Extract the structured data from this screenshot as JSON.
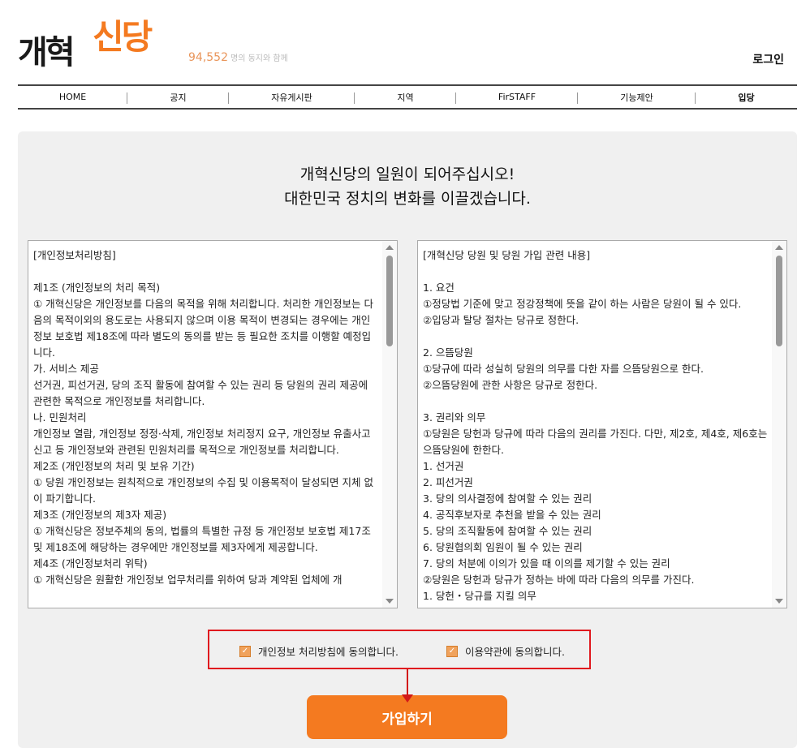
{
  "header": {
    "logo": {
      "black_text": "개혁",
      "orange_text": "신당"
    },
    "member_count": "94,552",
    "member_suffix": "명의 동지와 함께",
    "login_label": "로그인"
  },
  "nav": {
    "items": [
      {
        "label": "HOME"
      },
      {
        "label": "공지"
      },
      {
        "label": "자유게시판"
      },
      {
        "label": "지역"
      },
      {
        "label": "FirSTAFF"
      },
      {
        "label": "기능제안"
      },
      {
        "label": "입당"
      }
    ]
  },
  "main": {
    "headline_line1": "개혁신당의 일원이 되어주십시오!",
    "headline_line2": "대한민국 정치의 변화를 이끌겠습니다.",
    "privacy_text": "[개인정보처리방침]\n\n제1조 (개인정보의 처리 목적)\n① 개혁신당은 개인정보를 다음의 목적을 위해 처리합니다. 처리한 개인정보는 다음의 목적이외의 용도로는 사용되지 않으며 이용 목적이 변경되는 경우에는 개인정보 보호법 제18조에 따라 별도의 동의를 받는 등 필요한 조치를 이행할 예정입니다.\n가. 서비스 제공\n선거권, 피선거권, 당의 조직 활동에 참여할 수 있는 권리 등 당원의 권리 제공에 관련한 목적으로 개인정보를 처리합니다.\n나. 민원처리\n개인정보 열람, 개인정보 정정·삭제, 개인정보 처리정지 요구, 개인정보 유출사고 신고 등 개인정보와 관련된 민원처리를 목적으로 개인정보를 처리합니다.\n제2조 (개인정보의 처리 및 보유 기간)\n① 당원 개인정보는 원칙적으로 개인정보의 수집 및 이용목적이 달성되면 지체 없이 파기합니다.\n제3조 (개인정보의 제3자 제공)\n① 개혁신당은 정보주체의 동의, 법률의 특별한 규정 등 개인정보 보호법 제17조 및 제18조에 해당하는 경우에만 개인정보를 제3자에게 제공합니다.\n제4조 (개인정보처리 위탁)\n① 개혁신당은 원활한 개인정보 업무처리를 위하여 당과 계약된 업체에 개",
    "terms_text": "[개혁신당 당원 및 당원 가입 관련 내용]\n\n1. 요건\n①정당법 기준에 맞고 정강정책에 뜻을 같이 하는 사람은 당원이 될 수 있다.\n②입당과 탈당 절차는 당규로 정한다.\n\n2. 으뜸당원\n①당규에 따라 성실히 당원의 의무를 다한 자를 으뜸당원으로 한다.\n②으뜸당원에 관한 사항은 당규로 정한다.\n\n3. 권리와 의무\n①당원은 당헌과 당규에 따라 다음의 권리를 가진다. 다만, 제2호, 제4호, 제6호는 으뜸당원에 한한다.\n1. 선거권\n2. 피선거권\n3. 당의 의사결정에 참여할 수 있는 권리\n4. 공직후보자로 추천을 받을 수 있는 권리\n5. 당의 조직활동에 참여할 수 있는 권리\n6. 당원협의회 임원이 될 수 있는 권리\n7. 당의 처분에 이의가 있을 때 이의를 제기할 수 있는 권리\n②당원은 당헌과 당규가 정하는 바에 따라 다음의 의무를 가진다.\n1. 당헌・당규를 지킬 의무"
  },
  "agreements": {
    "privacy_label": "개인정보 처리방침에 동의합니다.",
    "privacy_checked": true,
    "terms_label": "이용약관에 동의합니다.",
    "terms_checked": true,
    "check_glyph": "✓"
  },
  "join_button_label": "가입하기",
  "colors": {
    "brand_orange": "#f47a20",
    "highlight_red": "#e0191e"
  }
}
